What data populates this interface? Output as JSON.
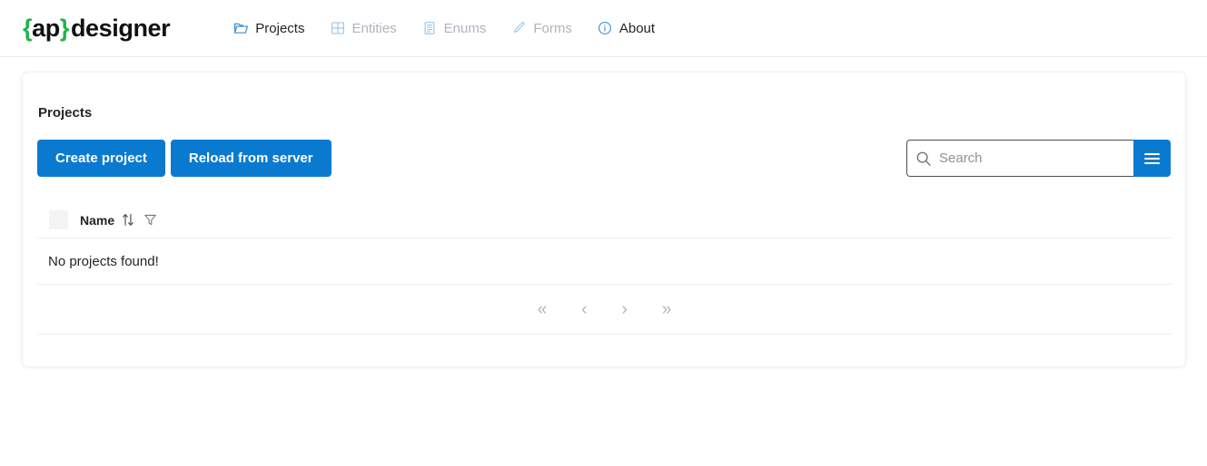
{
  "brand": {
    "open_brace": "{",
    "ap": "ap",
    "close_brace": "}",
    "designer": "designer",
    "accent_color": "#22b24c"
  },
  "nav": {
    "items": [
      {
        "label": "Projects",
        "icon": "folder-open-icon",
        "state": "active"
      },
      {
        "label": "Entities",
        "icon": "table-grid-icon",
        "state": "disabled"
      },
      {
        "label": "Enums",
        "icon": "list-document-icon",
        "state": "disabled"
      },
      {
        "label": "Forms",
        "icon": "pencil-icon",
        "state": "disabled"
      },
      {
        "label": "About",
        "icon": "info-circle-icon",
        "state": "active"
      }
    ]
  },
  "card": {
    "title": "Projects",
    "buttons": {
      "create": "Create project",
      "reload": "Reload from server"
    },
    "search": {
      "value": "",
      "placeholder": "Search",
      "icon": "search-icon",
      "menu_icon": "hamburger-menu-icon"
    },
    "table": {
      "columns": [
        {
          "key": "select",
          "label": ""
        },
        {
          "key": "name",
          "label": "Name",
          "sort_icon": "sort-updown-icon",
          "filter_icon": "funnel-filter-icon"
        }
      ],
      "rows": [],
      "empty_message": "No projects found!"
    },
    "pagination": {
      "first": "«",
      "prev": "‹",
      "next": "›",
      "last": "»"
    }
  },
  "theme": {
    "primary": "#0a7ad1",
    "muted_text": "#adb5bd",
    "border": "#eceeef"
  }
}
